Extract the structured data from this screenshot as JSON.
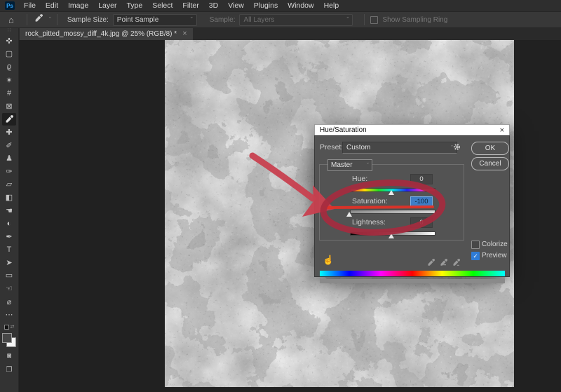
{
  "menu_bar": {
    "items": [
      "File",
      "Edit",
      "Image",
      "Layer",
      "Type",
      "Select",
      "Filter",
      "3D",
      "View",
      "Plugins",
      "Window",
      "Help"
    ]
  },
  "options_bar": {
    "sample_size_label": "Sample Size:",
    "sample_size_value": "Point Sample",
    "sample_label": "Sample:",
    "sample_value": "All Layers",
    "show_sampling_ring_label": "Show Sampling Ring"
  },
  "document_tab": {
    "title": "rock_pitted_mossy_diff_4k.jpg @ 25% (RGB/8) *",
    "close": "×"
  },
  "toolbar": {
    "tools": [
      {
        "name": "move-tool",
        "glyph": "✜"
      },
      {
        "name": "marquee-tool",
        "glyph": "▢"
      },
      {
        "name": "lasso-tool",
        "glyph": "ϱ"
      },
      {
        "name": "magic-wand-tool",
        "glyph": "✶"
      },
      {
        "name": "crop-tool",
        "glyph": "#"
      },
      {
        "name": "frame-tool",
        "glyph": "⊠"
      },
      {
        "name": "eyedropper-tool",
        "icon": "dropper",
        "selected": true
      },
      {
        "name": "healing-brush-tool",
        "glyph": "✚"
      },
      {
        "name": "brush-tool",
        "glyph": "✐"
      },
      {
        "name": "clone-stamp-tool",
        "glyph": "♟"
      },
      {
        "name": "history-brush-tool",
        "glyph": "✑"
      },
      {
        "name": "eraser-tool",
        "glyph": "▱"
      },
      {
        "name": "gradient-tool",
        "glyph": "◧"
      },
      {
        "name": "smudge-tool",
        "glyph": "☚"
      },
      {
        "name": "dodge-tool",
        "glyph": "◐"
      },
      {
        "name": "pen-tool",
        "glyph": "✒"
      },
      {
        "name": "type-tool",
        "glyph": "T"
      },
      {
        "name": "path-select-tool",
        "glyph": "➤"
      },
      {
        "name": "shape-tool",
        "glyph": "▭"
      },
      {
        "name": "hand-tool",
        "glyph": "☜"
      },
      {
        "name": "zoom-tool",
        "glyph": "⌀"
      },
      {
        "name": "toolbar-options",
        "glyph": "⋯"
      }
    ]
  },
  "dialog": {
    "title": "Hue/Saturation",
    "close": "×",
    "preset_label": "Preset:",
    "preset_value": "Custom",
    "ok_label": "OK",
    "cancel_label": "Cancel",
    "channel_value": "Master",
    "sliders": [
      {
        "label": "Hue:",
        "value": "0"
      },
      {
        "label": "Saturation:",
        "value": "-100",
        "selected": true
      },
      {
        "label": "Lightness:",
        "value": "0"
      }
    ],
    "colorize_label": "Colorize",
    "colorize_checked": false,
    "preview_label": "Preview",
    "preview_checked": true,
    "check_glyph": "✓"
  },
  "colors": {
    "selection_blue": "#3f7ec6",
    "accent_checkbox_blue": "#2f7cd6",
    "annotation_ellipse_red": "#a62b3f",
    "annotation_arrow_red": "#c8404f",
    "annotation_line_red": "#e03227",
    "dialog_body_gray": "#535353"
  }
}
